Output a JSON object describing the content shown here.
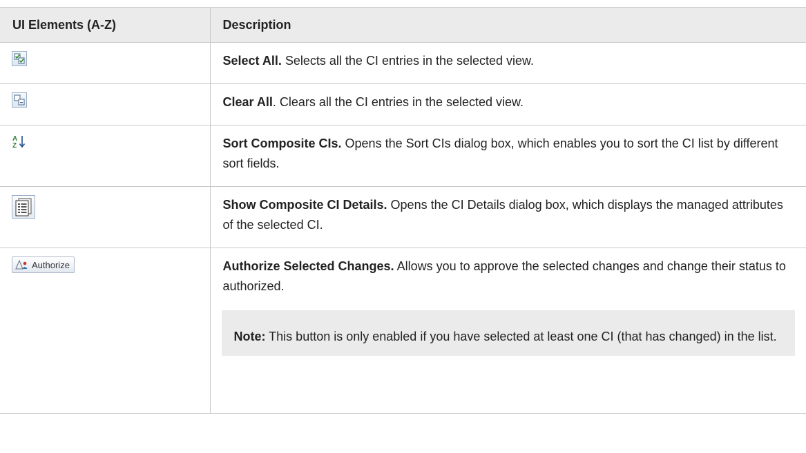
{
  "table": {
    "headers": [
      "UI Elements (A-Z)",
      "Description"
    ],
    "rows": [
      {
        "icon": "select-all-icon",
        "term": "Select All.",
        "text": " Selects all the CI entries in the selected view."
      },
      {
        "icon": "clear-all-icon",
        "term": "Clear All",
        "text": ". Clears all the CI entries in the selected view."
      },
      {
        "icon": "sort-az-icon",
        "term": "Sort Composite CIs.",
        "text": " Opens the Sort CIs dialog box, which enables you to sort the CI list by different sort fields."
      },
      {
        "icon": "ci-details-icon",
        "term": "Show Composite CI Details.",
        "text": " Opens the CI Details dialog box, which displays the managed attributes of the selected CI."
      },
      {
        "icon": "authorize-icon",
        "button_label": "Authorize",
        "term": "Authorize Selected Changes.",
        "text": " Allows you to approve the selected changes and change their status to authorized.",
        "note_label": "Note:",
        "note_text": " This button is only enabled if you have selected at least one CI (that has changed) in the list."
      }
    ]
  }
}
